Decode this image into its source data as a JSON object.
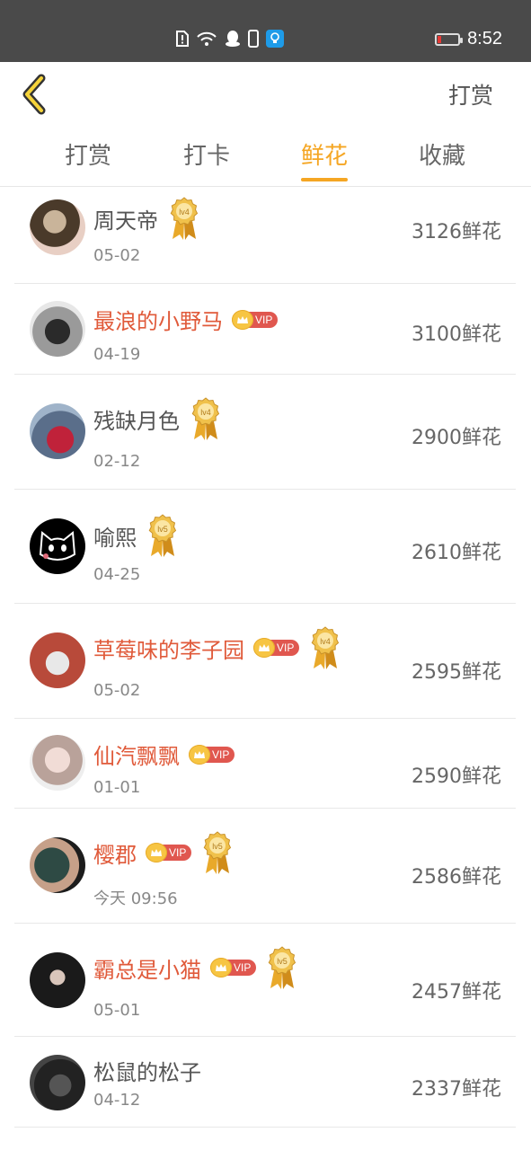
{
  "status_bar": {
    "time": "8:52"
  },
  "header": {
    "action_label": "打赏"
  },
  "tabs": [
    {
      "label": "打赏",
      "active": false
    },
    {
      "label": "打卡",
      "active": false
    },
    {
      "label": "鲜花",
      "active": true
    },
    {
      "label": "收藏",
      "active": false
    }
  ],
  "colors": {
    "accent": "#f5a623",
    "vip_name": "#e05a3a",
    "vip_badge": "#e0574f"
  },
  "list": [
    {
      "name": "周天帝",
      "vip": false,
      "level": "lv4",
      "date": "05-02",
      "score": "3126鲜花"
    },
    {
      "name": "最浪的小野马",
      "vip": true,
      "level": null,
      "date": "04-19",
      "score": "3100鲜花"
    },
    {
      "name": "残缺月色",
      "vip": false,
      "level": "lv4",
      "date": "02-12",
      "score": "2900鲜花"
    },
    {
      "name": "喻熙",
      "vip": false,
      "level": "lv5",
      "date": "04-25",
      "score": "2610鲜花"
    },
    {
      "name": "草莓味的李子园",
      "vip": true,
      "level": "lv4",
      "date": "05-02",
      "score": "2595鲜花"
    },
    {
      "name": "仙汽飘飘",
      "vip": true,
      "level": null,
      "date": "01-01",
      "score": "2590鲜花"
    },
    {
      "name": "樱郡",
      "vip": true,
      "level": "lv5",
      "date": "今天 09:56",
      "score": "2586鲜花"
    },
    {
      "name": "霸总是小猫",
      "vip": true,
      "level": "lv5",
      "date": "05-01",
      "score": "2457鲜花"
    },
    {
      "name": "松鼠的松子",
      "vip": false,
      "level": null,
      "date": "04-12",
      "score": "2337鲜花"
    }
  ],
  "vip_label": "VIP"
}
